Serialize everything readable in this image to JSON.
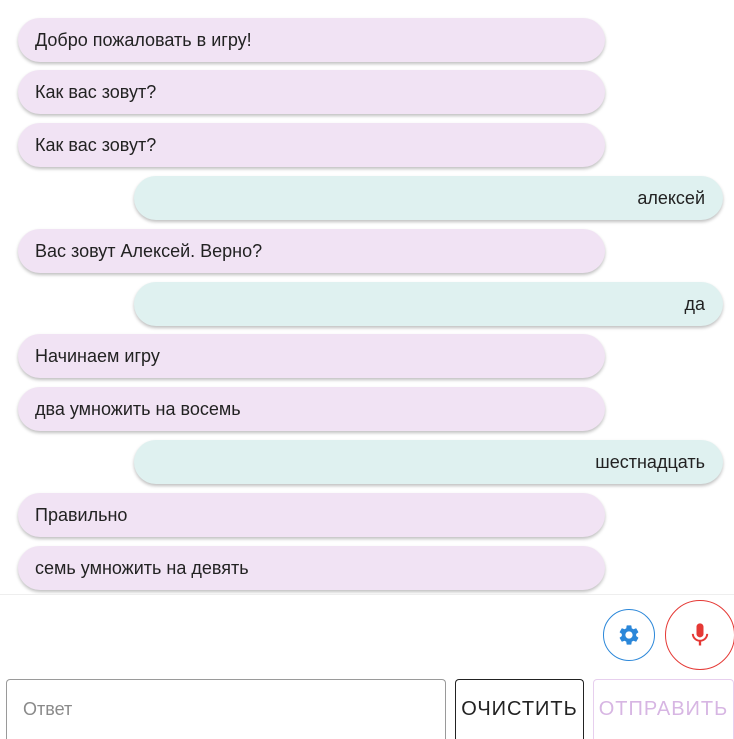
{
  "messages": [
    {
      "role": "bot",
      "text": "Добро пожаловать в игру!"
    },
    {
      "role": "bot",
      "text": "Как вас зовут?"
    },
    {
      "role": "bot",
      "text": "Как вас зовут?"
    },
    {
      "role": "user",
      "text": "алексей"
    },
    {
      "role": "bot",
      "text": "Вас зовут Алексей. Верно?"
    },
    {
      "role": "user",
      "text": "да"
    },
    {
      "role": "bot",
      "text": "Начинаем игру"
    },
    {
      "role": "bot",
      "text": "два умножить на восемь"
    },
    {
      "role": "user",
      "text": "шестнадцать"
    },
    {
      "role": "bot",
      "text": "Правильно"
    },
    {
      "role": "bot",
      "text": "семь умножить на девять"
    }
  ],
  "controls": {
    "settings_icon": "gear-icon",
    "mic_icon": "microphone-icon",
    "answer_placeholder": "Ответ",
    "answer_value": "",
    "clear_label": "ОЧИСТИТЬ",
    "send_label": "ОТПРАВИТЬ",
    "send_enabled": false
  },
  "colors": {
    "bot_bubble": "#f1e3f4",
    "user_bubble": "#dff1f0",
    "settings_accent": "#2b87d9",
    "mic_accent": "#e53935",
    "send_disabled": "#d7b6e3"
  }
}
